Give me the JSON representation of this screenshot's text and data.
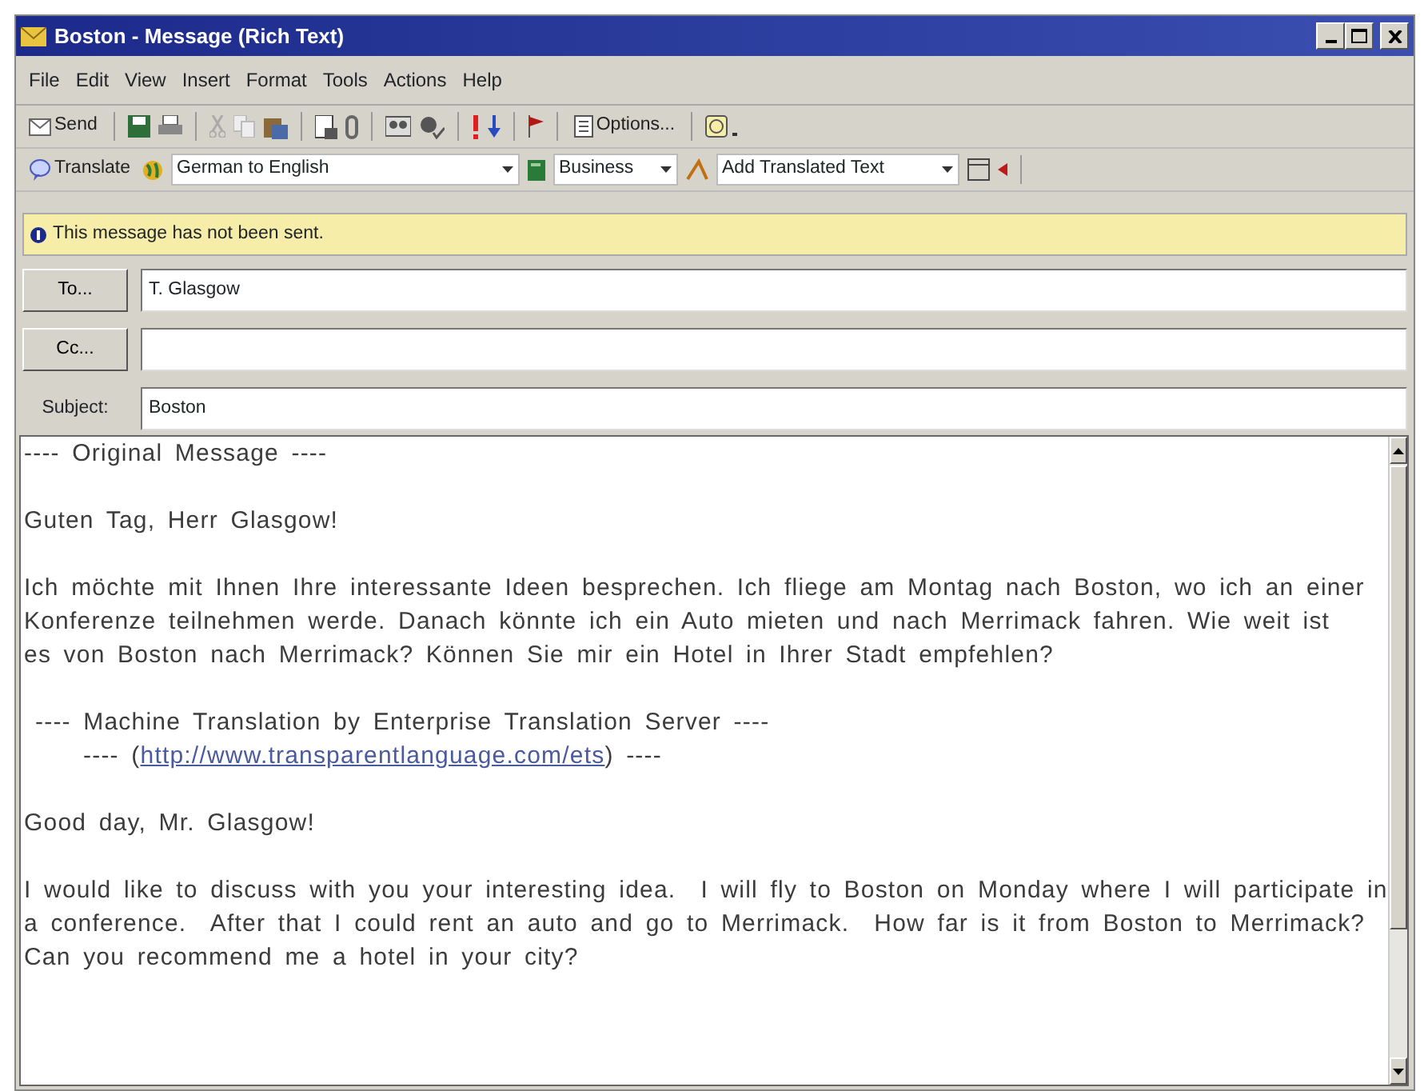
{
  "window": {
    "title": "Boston - Message (Rich Text)"
  },
  "menu": [
    "File",
    "Edit",
    "View",
    "Insert",
    "Format",
    "Tools",
    "Actions",
    "Help"
  ],
  "toolbar": {
    "send": "Send",
    "options": "Options..."
  },
  "translate_bar": {
    "button": "Translate",
    "language": "German to English",
    "domain": "Business",
    "mode": "Add Translated Text"
  },
  "info_bar": "This message has not been sent.",
  "header": {
    "to_button": "To...",
    "to": "T. Glasgow",
    "cc_button": "Cc...",
    "subject_label": "Subject:",
    "subject": "Boston"
  },
  "body": [
    {
      "kind": "line",
      "lines": [
        "---- Original Message ----"
      ]
    },
    {
      "kind": "line",
      "lines": [
        "Guten Tag, Herr Glasgow!"
      ]
    },
    {
      "kind": "line",
      "lines": [
        "Ich möchte mit Ihnen Ihre interessante Ideen besprechen. Ich fliege am Montag nach Boston, wo ich an einer",
        "Konferenze teilnehmen werde. Danach könnte ich ein Auto mieten und nach Merrimack fahren. Wie weit ist",
        "es von Boston nach Merrimack? Können Sie mir ein Hotel in Ihrer Stadt empfehlen?"
      ]
    },
    {
      "kind": "banner",
      "lines": [
        "---- Machine Translation by Enterprise Translation Server ----"
      ]
    },
    {
      "kind": "link",
      "before": "---- (",
      "link": "http://www.transparentlanguage.com/ets",
      "after": ") ----"
    },
    {
      "kind": "line",
      "lines": [
        "Good day, Mr. Glasgow!"
      ]
    },
    {
      "kind": "line",
      "lines": [
        "I would like to discuss with you your interesting idea.  I will fly to Boston on Monday where I will participate in",
        "a conference.  After that I could rent an auto and go to Merrimack.  How far is it from Boston to Merrimack?",
        "Can you recommend me a hotel in your city?"
      ]
    }
  ]
}
